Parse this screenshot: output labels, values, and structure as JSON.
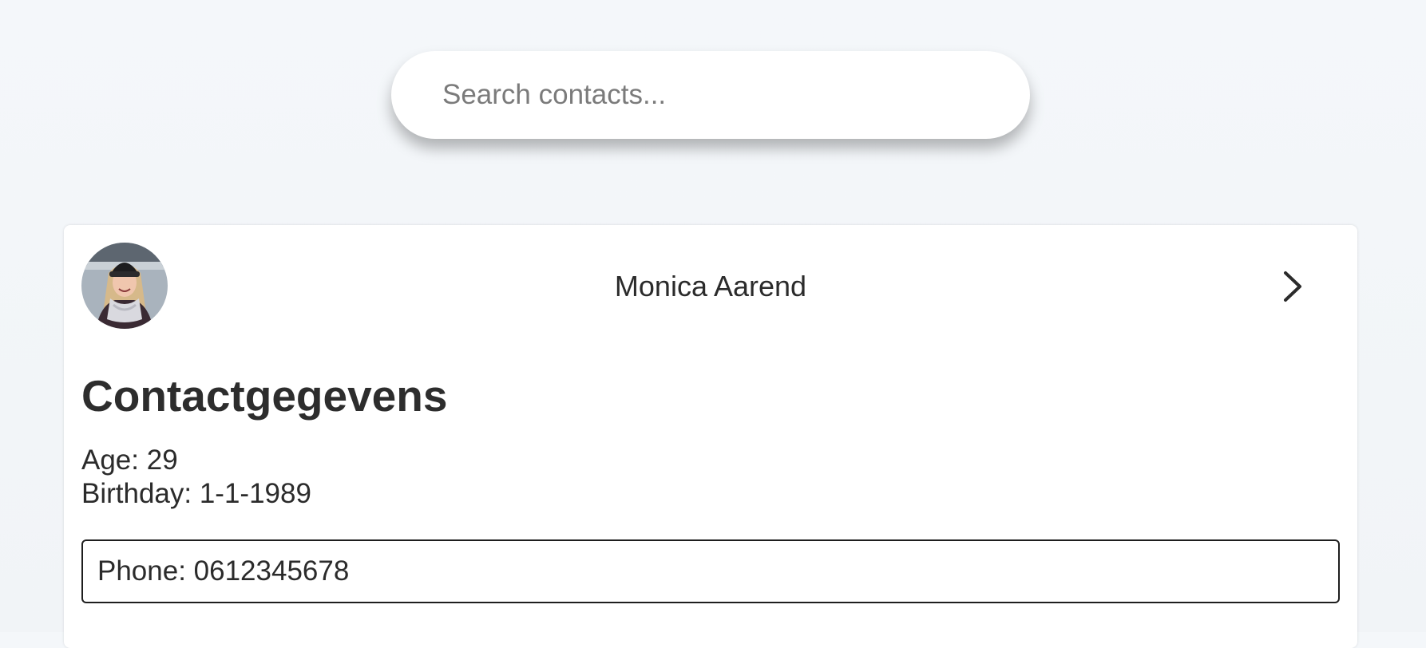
{
  "search": {
    "placeholder": "Search contacts..."
  },
  "contact": {
    "avatar_icon": "avatar-photo",
    "name": "Monica Aarend",
    "expand_icon": "chevron-right-icon",
    "section_title": "Contactgegevens",
    "age_text": "Age: 29",
    "birthday_text": "Birthday: 1-1-1989",
    "phone_text": "Phone: 0612345678"
  }
}
